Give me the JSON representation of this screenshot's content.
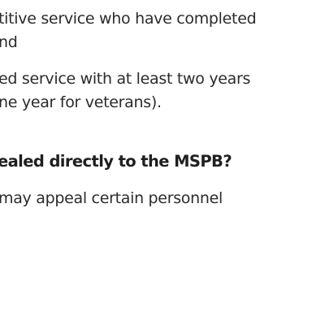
{
  "content": {
    "para1_line1": "titive service who have completed",
    "para1_line2": "nd",
    "para2_line1": "ed service with at least two years",
    "para2_line2": "ne year for veterans).",
    "heading": "ealed directly to the MSPB?",
    "para3_line1": " may appeal certain personnel"
  }
}
